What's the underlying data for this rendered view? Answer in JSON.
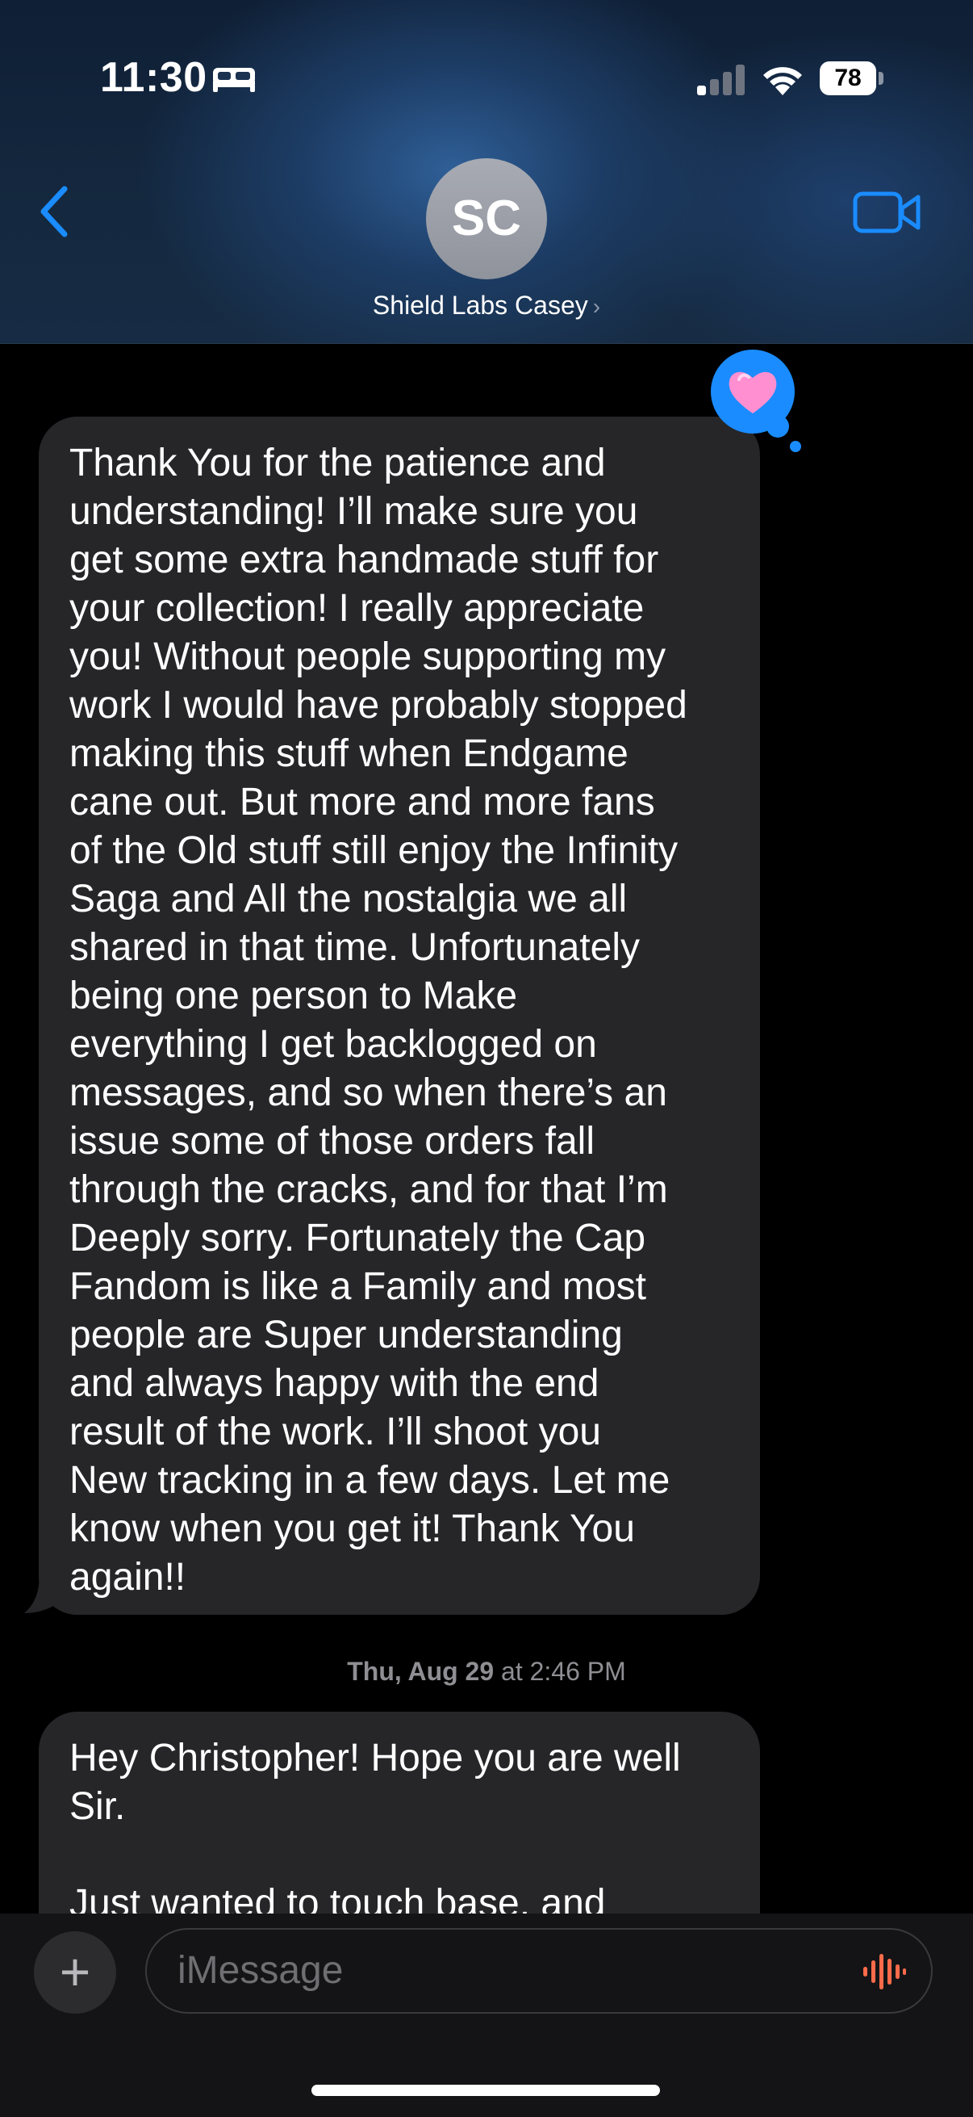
{
  "status_bar": {
    "time": "11:30",
    "battery_percent": "78",
    "battery_level": 0.78,
    "icons": [
      "bed-icon",
      "cellular-signal-icon",
      "wifi-icon",
      "battery-icon"
    ]
  },
  "header": {
    "avatar_initials": "SC",
    "contact_name": "Shield Labs Casey",
    "contact_chevron": "›",
    "back_icon": "chevron-left-icon",
    "video_icon": "video-camera-icon"
  },
  "messages": [
    {
      "sender": "incoming",
      "reaction": "heart",
      "text": "Thank You for the patience and\nunderstanding! I’ll make sure you\nget some extra handmade stuff for\nyour collection! I really appreciate\nyou! Without people supporting my\nwork I would have probably stopped\nmaking this stuff when Endgame\ncane out. But more and more fans\nof the Old stuff still enjoy the Infinity\nSaga and All the nostalgia we all\nshared in that time. Unfortunately\nbeing one person to Make\neverything I get backlogged on\nmessages, and so when there’s an\nissue some of those orders fall\nthrough the cracks, and for that I’m\nDeeply sorry. Fortunately the Cap\nFandom is like a Family and most\npeople are Super understanding\nand always happy with the end\nresult of the work. I’ll shoot you\nNew tracking in a few days. Let me\nknow when you get it! Thank You\nagain!!"
    },
    {
      "sender": "incoming",
      "text": "Hey Christopher! Hope you are well\nSir.\n\nJust wanted to touch base, and"
    }
  ],
  "timestamp": {
    "day": "Thu, Aug 29",
    "rest": " at 2:46 PM"
  },
  "composer": {
    "plus_label": "+",
    "placeholder": "iMessage",
    "audio_icon": "audio-waveform-icon"
  },
  "colors": {
    "accent": "#1a8cff",
    "bubble_incoming": "#262628",
    "audio_icon": "#ff6b4a",
    "reaction_heart": "#ff8fd0"
  }
}
